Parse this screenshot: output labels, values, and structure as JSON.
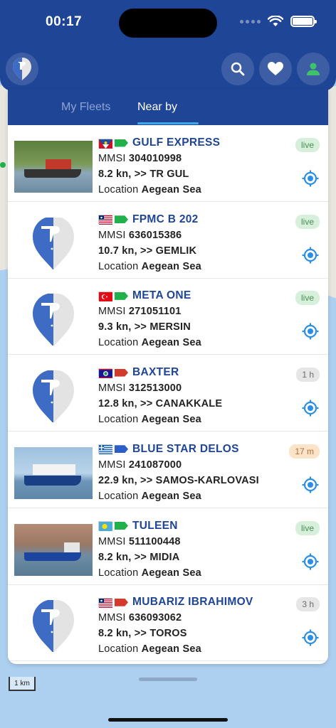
{
  "status_bar": {
    "time": "00:17"
  },
  "tabs": [
    {
      "label": "My Fleets",
      "active": false
    },
    {
      "label": "Near by",
      "active": true
    }
  ],
  "colors": {
    "header": "#1f4596",
    "name": "#1f4596",
    "accent": "#2b8fe6"
  },
  "ships": [
    {
      "name": "GULF EXPRESS",
      "mmsi": "304010998",
      "speed": "8.2 kn, >> TR GUL",
      "location": "Aegean Sea",
      "status": "live",
      "flag": "antigua-barbuda",
      "ais_color": "#21b14b",
      "thumb": "photo"
    },
    {
      "name": "FPMC B 202",
      "mmsi": "636015386",
      "speed": "10.7 kn, >> GEMLIK",
      "location": "Aegean Sea",
      "status": "live",
      "flag": "liberia",
      "ais_color": "#21b14b",
      "thumb": "placeholder"
    },
    {
      "name": "META ONE",
      "mmsi": "271051101",
      "speed": "9.3 kn, >> MERSIN",
      "location": "Aegean Sea",
      "status": "live",
      "flag": "turkey",
      "ais_color": "#21b14b",
      "thumb": "placeholder"
    },
    {
      "name": "BAXTER",
      "mmsi": "312513000",
      "speed": "12.8 kn, >> CANAKKALE",
      "location": "Aegean Sea",
      "status": "1 h",
      "flag": "belize",
      "ais_color": "#d23b2b",
      "thumb": "placeholder"
    },
    {
      "name": "BLUE STAR DELOS",
      "mmsi": "241087000",
      "speed": "22.9 kn, >> SAMOS-KARLOVASI",
      "location": "Aegean Sea",
      "status": "17 m",
      "flag": "greece",
      "ais_color": "#2b5ec8",
      "thumb": "photo"
    },
    {
      "name": "TULEEN",
      "mmsi": "511100448",
      "speed": "8.2 kn, >> MIDIA",
      "location": "Aegean Sea",
      "status": "live",
      "flag": "palau",
      "ais_color": "#21b14b",
      "thumb": "photo"
    },
    {
      "name": "MUBARIZ IBRAHIMOV",
      "mmsi": "636093062",
      "speed": "8.2 kn, >> TOROS",
      "location": "Aegean Sea",
      "status": "3 h",
      "flag": "liberia",
      "ais_color": "#d23b2b",
      "thumb": "placeholder"
    }
  ],
  "labels": {
    "mmsi": "MMSI",
    "location": "Location"
  },
  "map": {
    "scale": "1 km"
  }
}
